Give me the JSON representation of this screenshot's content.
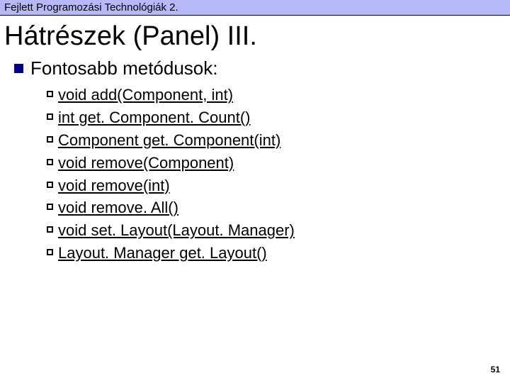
{
  "header": "Fejlett Programozási Technológiák 2.",
  "title": "Hátrészek (Panel) III.",
  "subheading": "Fontosabb metódusok:",
  "methods": [
    "void add(Component, int)",
    "int get. Component. Count()",
    "Component get. Component(int)",
    "void remove(Component)",
    "void remove(int)",
    "void remove. All()",
    "void set. Layout(Layout. Manager)",
    "Layout. Manager get. Layout()"
  ],
  "page_number": "51"
}
